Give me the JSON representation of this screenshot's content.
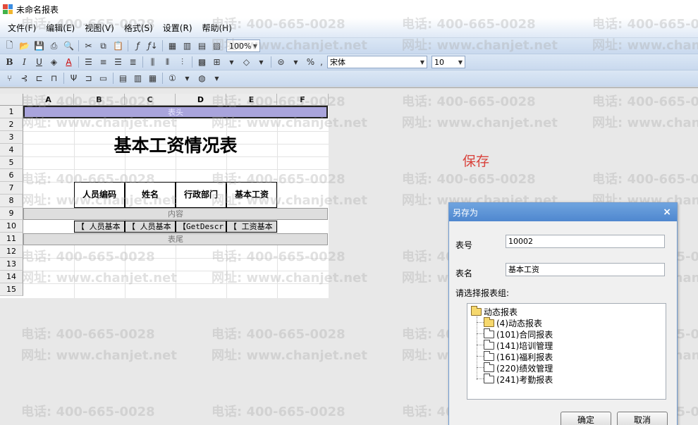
{
  "window": {
    "title": "未命名报表"
  },
  "menu": [
    "文件(F)",
    "编辑(E)",
    "视图(V)",
    "格式(S)",
    "设置(R)",
    "帮助(H)"
  ],
  "toolbar": {
    "zoom": "100%",
    "font": "宋体",
    "font_size": "10",
    "percent_symbol": "%"
  },
  "grid": {
    "columns": [
      "A",
      "B",
      "C",
      "D",
      "E",
      "F"
    ],
    "rows": [
      "1",
      "2",
      "3",
      "4",
      "5",
      "6",
      "7",
      "8",
      "9",
      "10",
      "11",
      "12",
      "13",
      "14",
      "15"
    ],
    "band_header": "表头",
    "band_content": "内容",
    "band_footer": "表尾",
    "report_title": "基本工资情况表",
    "table_headers": [
      "人员编码",
      "姓名",
      "行政部门",
      "基本工资"
    ],
    "table_cells": [
      "【 人员基本",
      "【 人员基本",
      "【GetDescr",
      "【 工资基本"
    ]
  },
  "annotation": {
    "save_label": "保存"
  },
  "dialog": {
    "title": "另存为",
    "close_symbol": "×",
    "code_label": "表号",
    "code_value": "10002",
    "name_label": "表名",
    "name_value": "基本工资",
    "group_label": "请选择报表组:",
    "tree_root": "动态报表",
    "tree_children": [
      "(4)动态报表",
      "(101)合同报表",
      "(141)培训管理",
      "(161)福利报表",
      "(220)绩效管理",
      "(241)考勤报表"
    ],
    "ok_label": "确定",
    "cancel_label": "取消"
  },
  "watermark": {
    "phone": "电话: 400-665-0028",
    "url": "网址: www.chanjet.net"
  }
}
